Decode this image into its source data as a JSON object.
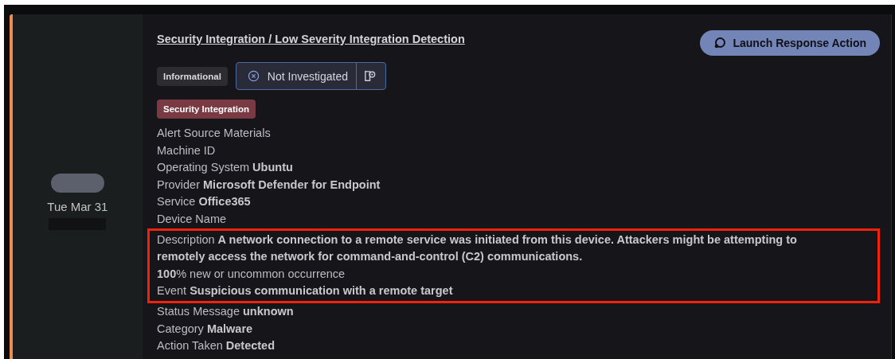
{
  "date": "Tue Mar 31",
  "title": "Security Integration / Low Severity Integration Detection",
  "launch_button": {
    "label": "Launch Response Action"
  },
  "severity_badge": "Informational",
  "status": {
    "label": "Not Investigated"
  },
  "tag": "Security Integration",
  "fields": [
    {
      "label": "Alert Source Materials",
      "highlighted": false,
      "kind": "label_first"
    },
    {
      "label": "Machine ID",
      "highlighted": false,
      "kind": "label_first"
    },
    {
      "label": "Operating System",
      "value": "Ubuntu",
      "highlighted": false,
      "kind": "label_first"
    },
    {
      "label": "Provider",
      "value": "Microsoft Defender for Endpoint",
      "highlighted": false,
      "kind": "label_first"
    },
    {
      "label": "Service",
      "value": "Office365",
      "highlighted": false,
      "kind": "label_first"
    },
    {
      "label": "Device Name",
      "highlighted": false,
      "kind": "label_first"
    },
    {
      "label": "Description",
      "value": "A network connection to a remote service was initiated from this device. Attackers might be attempting to remotely access the network for command-and-control (C2) communications.",
      "highlighted": true,
      "kind": "label_first"
    },
    {
      "label": "% new or uncommon occurrence",
      "value": "100",
      "highlighted": true,
      "kind": "value_first"
    },
    {
      "label": "Event",
      "value": "Suspicious communication with a remote target",
      "highlighted": true,
      "kind": "label_first"
    },
    {
      "label": "Status Message",
      "value": "unknown",
      "highlighted": false,
      "kind": "label_first"
    },
    {
      "label": "Category",
      "value": "Malware",
      "highlighted": false,
      "kind": "label_first"
    },
    {
      "label": "Action Taken",
      "value": "Detected",
      "highlighted": false,
      "kind": "label_first"
    }
  ]
}
